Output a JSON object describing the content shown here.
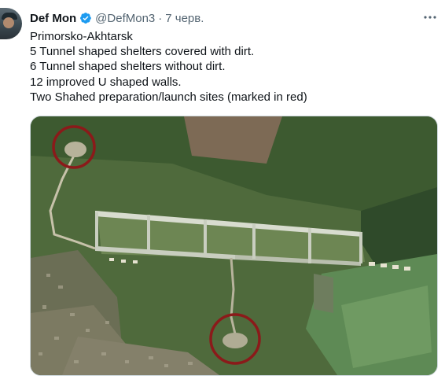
{
  "author": {
    "name": "Def Mon",
    "handle": "@DefMon3",
    "date": "7 черв.",
    "verified_color": "#1d9bf0"
  },
  "lines": [
    "Primorsko-Akhtarsk",
    "5 Tunnel shaped shelters covered with dirt.",
    "6 Tunnel shaped shelters without dirt.",
    "12 improved U shaped walls.",
    "Two Shahed preparation/launch sites (marked in red)"
  ],
  "icons": {
    "verified": "verified-badge-icon",
    "more": "more-options-icon"
  },
  "colors": {
    "marker": "#8b1a1a",
    "text_secondary": "#536471"
  }
}
